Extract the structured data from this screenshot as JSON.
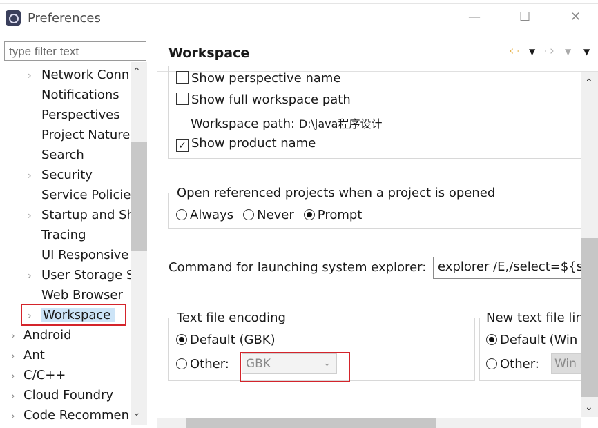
{
  "window": {
    "title": "Preferences",
    "minimize_glyph": "—",
    "maximize_glyph": "☐",
    "close_glyph": "✕"
  },
  "filter": {
    "placeholder": "type filter text"
  },
  "tree": {
    "children": [
      {
        "label": "Network Conn",
        "expander": true
      },
      {
        "label": "Notifications",
        "expander": false
      },
      {
        "label": "Perspectives",
        "expander": false
      },
      {
        "label": "Project Nature",
        "expander": false
      },
      {
        "label": "Search",
        "expander": false
      },
      {
        "label": "Security",
        "expander": true
      },
      {
        "label": "Service Policie",
        "expander": false
      },
      {
        "label": "Startup and Sh",
        "expander": true
      },
      {
        "label": "Tracing",
        "expander": false
      },
      {
        "label": "UI Responsive",
        "expander": false
      },
      {
        "label": "User Storage S",
        "expander": true
      },
      {
        "label": "Web Browser",
        "expander": false
      },
      {
        "label": "Workspace",
        "expander": true,
        "selected": true
      }
    ],
    "roots": [
      "Android",
      "Ant",
      "C/C++",
      "Cloud Foundry",
      "Code Recommen"
    ]
  },
  "page": {
    "title": "Workspace",
    "show_perspective_name": "Show perspective name",
    "show_full_path": "Show full workspace path",
    "workspace_path_label": "Workspace path:",
    "workspace_path_value": "D:\\java程序设计",
    "show_product_name": "Show product name",
    "show_product_name_checked": true,
    "open_ref_label": "Open referenced projects when a project is opened",
    "open_ref_options": [
      "Always",
      "Never",
      "Prompt"
    ],
    "open_ref_selected": "Prompt",
    "explorer_label": "Command for launching system explorer:",
    "explorer_value": "explorer /E,/select=${s",
    "encoding": {
      "label": "Text file encoding",
      "default_label": "Default (GBK)",
      "other_label": "Other:",
      "other_value": "GBK",
      "selected": "default"
    },
    "line_delim": {
      "label": "New text file lin",
      "default_label": "Default (Win",
      "other_label": "Other:",
      "other_value": "Win",
      "selected": "default"
    }
  },
  "colors": {
    "selection": "#cce4f7",
    "highlight_box": "#d4242b",
    "nav_back": "#e0a020"
  }
}
